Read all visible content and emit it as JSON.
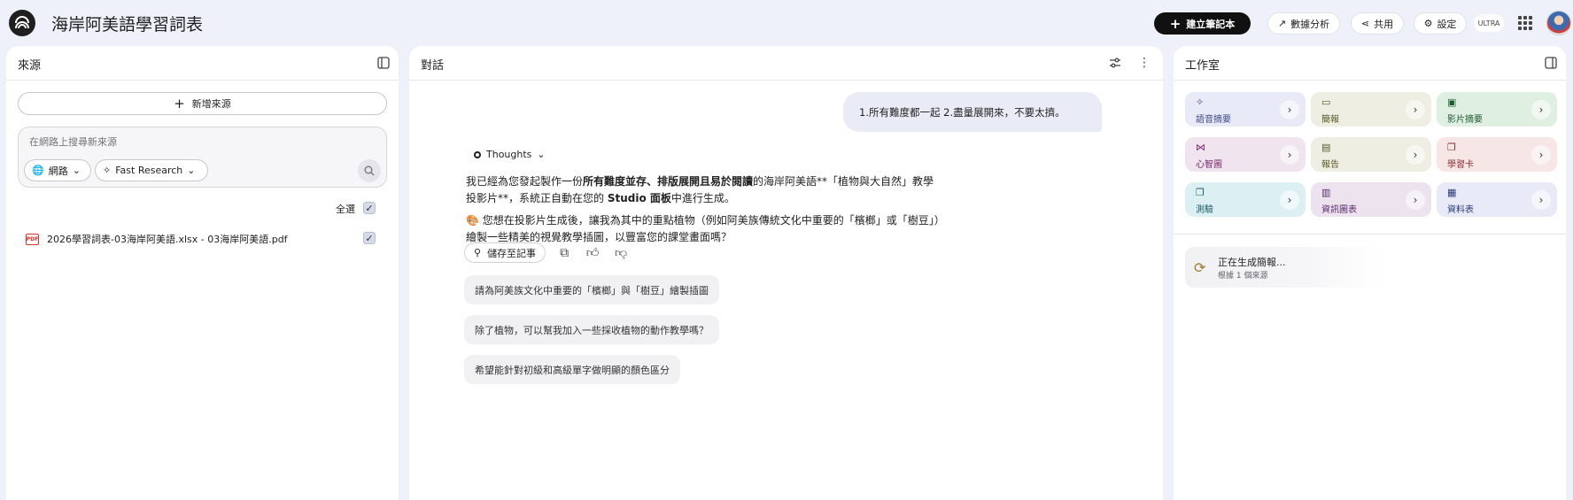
{
  "header": {
    "title": "海岸阿美語學習詞表",
    "create_notebook": "建立筆記本",
    "analytics": "數據分析",
    "share": "共用",
    "settings": "設定",
    "plan_badge": "ULTRA"
  },
  "sources": {
    "title": "來源",
    "add_source": "新增來源",
    "search_placeholder": "在網路上搜尋新來源",
    "web_chip": "網路",
    "research_chip": "Fast Research",
    "select_all": "全選",
    "items": [
      {
        "name": "2026學習詞表-03海岸阿美語.xlsx - 03海岸阿美語.pdf",
        "checked": true
      }
    ]
  },
  "chat": {
    "title": "對話",
    "user_message": "1.所有難度都一起 2.盡量展開來，不要太擠。",
    "thoughts_label": "Thoughts",
    "reply": {
      "p1_a": "我已經為您發起製作一份",
      "p1_b": "所有難度並存、排版展開且易於閱讀",
      "p1_c": "的海岸阿美語**「植物與大自然」教學投影片**，系統正自動在您的 ",
      "p1_d": "Studio 面板",
      "p1_e": "中進行生成。",
      "p2_emoji": "🎨",
      "p2": " 您想在投影片生成後，讓我為其中的重點植物（例如阿美族傳統文化中重要的「檳榔」或「樹豆」）繪製一些精美的視覺教學插圖，以豐富您的課堂畫面嗎？"
    },
    "save_to_note": "儲存至記事",
    "suggestions": [
      "請為阿美族文化中重要的「檳榔」與「樹豆」繪製插圖",
      "除了植物，可以幫我加入一些採收植物的動作教學嗎？",
      "希望能針對初級和高級單字做明顯的顏色區分"
    ]
  },
  "studio": {
    "title": "工作室",
    "tools": [
      {
        "label": "語音摘要",
        "icon": "audio-overview-icon",
        "bg": "#e8eaf7",
        "color": "#3c4a8a",
        "glyph": "✧"
      },
      {
        "label": "簡報",
        "icon": "slides-icon",
        "bg": "#eeeee2",
        "color": "#5a5a2a",
        "glyph": "▭"
      },
      {
        "label": "影片摘要",
        "icon": "video-overview-icon",
        "bg": "#dff0e3",
        "color": "#1e5a30",
        "glyph": "▣"
      },
      {
        "label": "心智圖",
        "icon": "mind-map-icon",
        "bg": "#f0e4ef",
        "color": "#7a2a6a",
        "glyph": "⋈"
      },
      {
        "label": "報告",
        "icon": "report-icon",
        "bg": "#eeeee2",
        "color": "#5a5a2a",
        "glyph": "▤"
      },
      {
        "label": "學習卡",
        "icon": "flashcards-icon",
        "bg": "#f6e6e6",
        "color": "#8a2a2a",
        "glyph": "❐"
      },
      {
        "label": "測驗",
        "icon": "quiz-icon",
        "bg": "#dcf0f4",
        "color": "#1e5a6a",
        "glyph": "❐"
      },
      {
        "label": "資訊圖表",
        "icon": "infographic-icon",
        "bg": "#ece3ef",
        "color": "#5a2a6a",
        "glyph": "▥"
      },
      {
        "label": "資料表",
        "icon": "data-table-icon",
        "bg": "#e8eaf7",
        "color": "#2a3a7a",
        "glyph": "▦"
      }
    ],
    "generating_title": "正在生成簡報...",
    "generating_sub": "根據 1 個來源"
  }
}
